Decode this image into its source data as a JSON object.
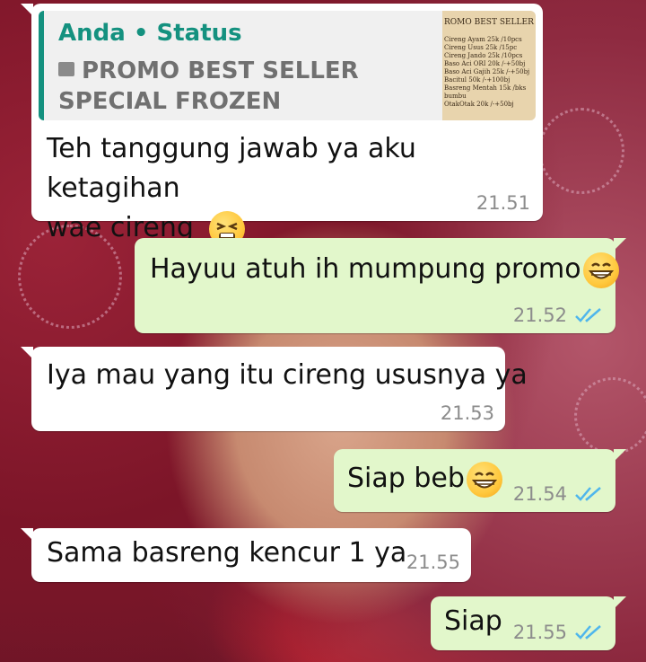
{
  "quoted_status": {
    "author": "Anda • Status",
    "text": "PROMO BEST SELLER SPECIAL FROZEN",
    "thumbnail": {
      "title": "ROMO BEST SELLER",
      "items": [
        "Cireng Ayam 25k /10pcs",
        "Cireng Usus 25k /15pc",
        "Cireng Jando 25k /10pcs",
        "Baso Aci ORI 20k /-+50bj",
        "Baso Aci Gajih 25k /-+50bj",
        "Bacitul 50k /-+100bj",
        "Basreng Mentah 15k /bks",
        "bumbu",
        "OtakOtak 20k /-+50bj"
      ]
    }
  },
  "messages": [
    {
      "id": "m1",
      "direction": "in",
      "text_line1": "Teh tanggung jawab ya aku ketagihan",
      "text_line2": "wae cireng",
      "emoji": "tired-face",
      "time": "21.51"
    },
    {
      "id": "m2",
      "direction": "out",
      "text": "Hayuu atuh ih mumpung promo",
      "emoji": "grinning-face",
      "time": "21.52",
      "read": true
    },
    {
      "id": "m3",
      "direction": "in",
      "text": "Iya mau yang itu cireng ususnya ya",
      "time": "21.53"
    },
    {
      "id": "m4",
      "direction": "out",
      "text": "Siap beb",
      "emoji": "grinning-face",
      "time": "21.54",
      "read": true
    },
    {
      "id": "m5",
      "direction": "in",
      "text": "Sama basreng kencur 1 ya",
      "time": "21.55"
    },
    {
      "id": "m6",
      "direction": "out",
      "text": "Siap",
      "time": "21.55",
      "read": true
    }
  ],
  "colors": {
    "incoming_bubble": "#ffffff",
    "outgoing_bubble": "#e2f7cb",
    "quote_accent": "#14917f",
    "read_ticks": "#4fb6ec",
    "timestamp": "#8c8c8c"
  }
}
